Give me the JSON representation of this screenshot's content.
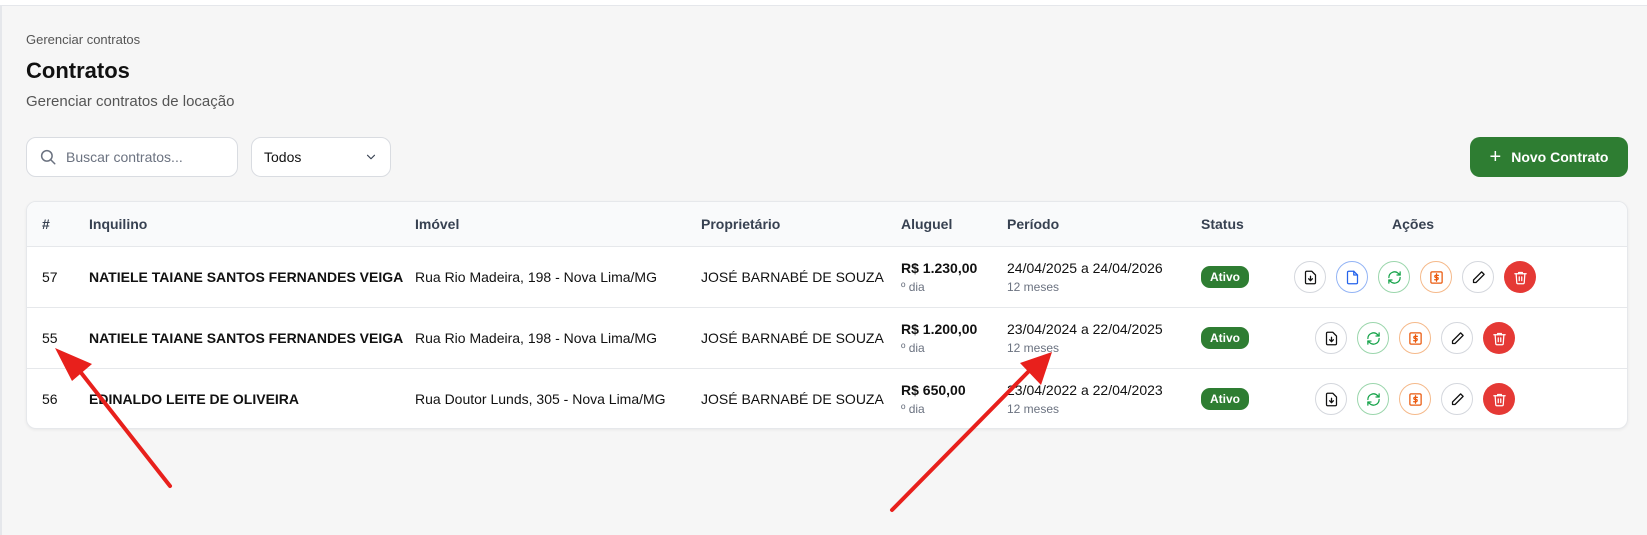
{
  "breadcrumb": "Gerenciar contratos",
  "page": {
    "title": "Contratos",
    "subtitle": "Gerenciar contratos de locação"
  },
  "toolbar": {
    "search_placeholder": "Buscar contratos...",
    "filter_value": "Todos",
    "new_button_label": "Novo Contrato"
  },
  "table": {
    "headers": {
      "id": "#",
      "tenant": "Inquilino",
      "property": "Imóvel",
      "owner": "Proprietário",
      "rent": "Aluguel",
      "period": "Período",
      "status": "Status",
      "actions": "Ações"
    },
    "rows": [
      {
        "id": "57",
        "tenant": "NATIELE TAIANE SANTOS FERNANDES VEIGA",
        "property": "Rua Rio Madeira, 198 - Nova Lima/MG",
        "owner": "JOSÉ BARNABÉ DE SOUZA",
        "rent": "R$ 1.230,00",
        "rent_note": "º dia",
        "period": "24/04/2025 a 24/04/2026",
        "duration": "12 meses",
        "status": "Ativo",
        "actions": [
          "download-icon",
          "document-icon",
          "refresh-icon",
          "payment-icon",
          "edit-icon",
          "trash-icon"
        ]
      },
      {
        "id": "55",
        "tenant": "NATIELE TAIANE SANTOS FERNANDES VEIGA",
        "property": "Rua Rio Madeira, 198 - Nova Lima/MG",
        "owner": "JOSÉ BARNABÉ DE SOUZA",
        "rent": "R$ 1.200,00",
        "rent_note": "º dia",
        "period": "23/04/2024 a 22/04/2025",
        "duration": "12 meses",
        "status": "Ativo",
        "actions": [
          "download-icon",
          "refresh-icon",
          "payment-icon",
          "edit-icon",
          "trash-icon"
        ]
      },
      {
        "id": "56",
        "tenant": "EDINALDO LEITE DE OLIVEIRA",
        "property": "Rua Doutor Lunds, 305 - Nova Lima/MG",
        "owner": "JOSÉ BARNABÉ DE SOUZA",
        "rent": "R$ 650,00",
        "rent_note": "º dia",
        "period": "23/04/2022 a 22/04/2023",
        "duration": "12 meses",
        "status": "Ativo",
        "actions": [
          "download-icon",
          "refresh-icon",
          "payment-icon",
          "edit-icon",
          "trash-icon"
        ]
      }
    ]
  },
  "colors": {
    "primary_green": "#2e7d32",
    "danger_red": "#e53935",
    "annotation_arrow": "#e8201c"
  }
}
